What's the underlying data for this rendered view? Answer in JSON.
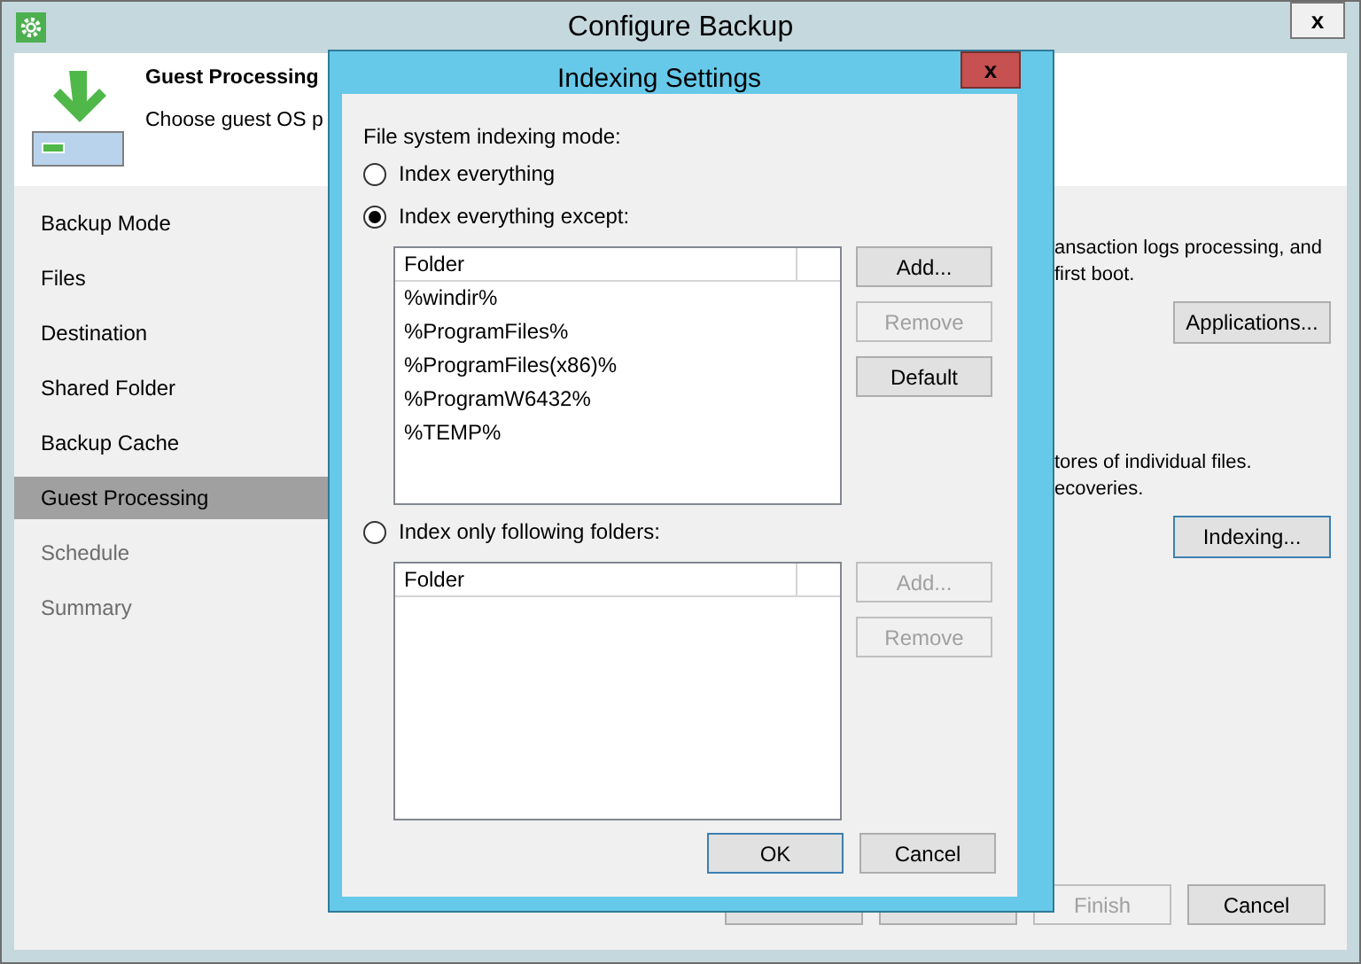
{
  "window": {
    "title": "Configure Backup",
    "close": "x"
  },
  "header": {
    "title": "Guest Processing",
    "description": "Choose guest OS p"
  },
  "steps": [
    {
      "label": "Backup Mode",
      "selected": false,
      "disabled": false
    },
    {
      "label": "Files",
      "selected": false,
      "disabled": false
    },
    {
      "label": "Destination",
      "selected": false,
      "disabled": false
    },
    {
      "label": "Shared Folder",
      "selected": false,
      "disabled": false
    },
    {
      "label": "Backup Cache",
      "selected": false,
      "disabled": false
    },
    {
      "label": "Guest Processing",
      "selected": true,
      "disabled": false
    },
    {
      "label": "Schedule",
      "selected": false,
      "disabled": true
    },
    {
      "label": "Summary",
      "selected": false,
      "disabled": true
    }
  ],
  "content": [
    {
      "lines": [
        "ansaction logs processing, and",
        "first boot."
      ],
      "button": {
        "label": "Applications...",
        "focused": false
      }
    },
    {
      "lines": [
        "tores of individual files.",
        "ecoveries."
      ],
      "button": {
        "label": "Indexing...",
        "focused": true
      }
    }
  ],
  "footer_buttons": [
    {
      "kind": "covered"
    },
    {
      "kind": "covered"
    },
    {
      "kind": "button",
      "label": "Finish",
      "disabled": true
    },
    {
      "kind": "button",
      "label": "Cancel",
      "disabled": false
    }
  ],
  "dialog": {
    "title": "Indexing Settings",
    "close": "x",
    "mode_label": "File system indexing mode:",
    "options": [
      {
        "label": "Index everything",
        "selected": false
      },
      {
        "label": "Index everything except:",
        "selected": true,
        "list": {
          "column": "Folder",
          "rows": [
            "%windir%",
            "%ProgramFiles%",
            "%ProgramFiles(x86)%",
            "%ProgramW6432%",
            "%TEMP%"
          ]
        },
        "buttons": [
          {
            "label": "Add...",
            "disabled": false
          },
          {
            "label": "Remove",
            "disabled": true
          },
          {
            "label": "Default",
            "disabled": false
          }
        ]
      },
      {
        "label": "Index only following folders:",
        "selected": false,
        "list": {
          "column": "Folder"
        },
        "buttons": [
          {
            "label": "Add...",
            "disabled": true
          },
          {
            "label": "Remove",
            "disabled": true
          }
        ]
      }
    ],
    "buttons": [
      {
        "label": "OK",
        "focused": true
      },
      {
        "label": "Cancel",
        "focused": false
      }
    ]
  }
}
